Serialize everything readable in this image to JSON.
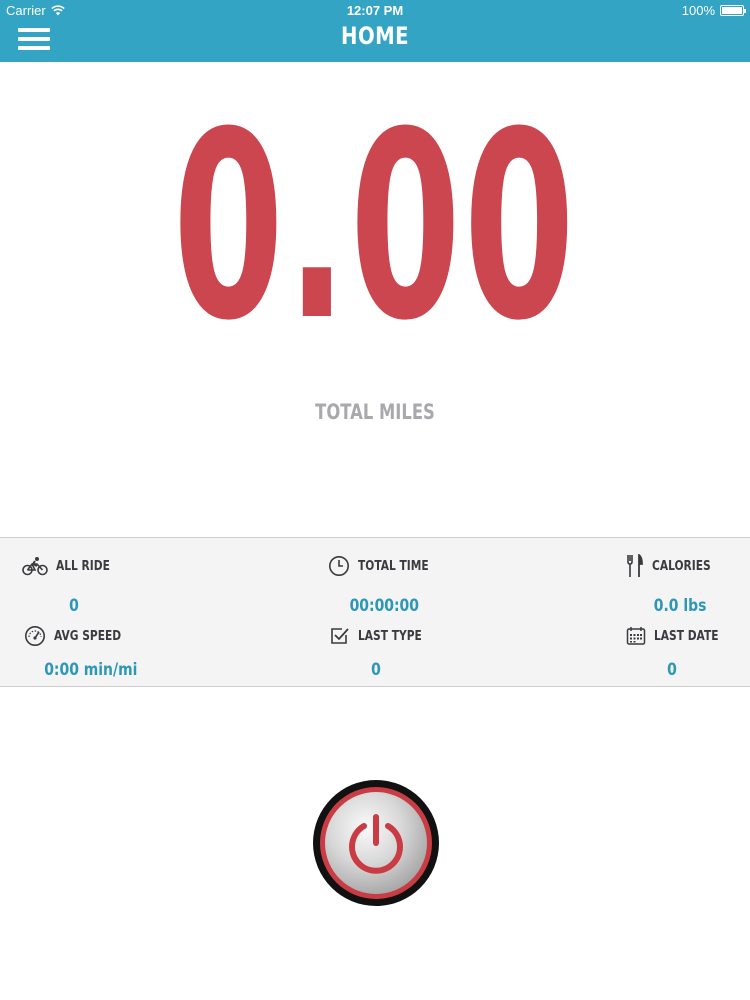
{
  "status_bar": {
    "carrier": "Carrier",
    "time": "12:07 PM",
    "battery": "100%"
  },
  "nav": {
    "title": "HOME",
    "menu_icon": "hamburger-menu-icon"
  },
  "main": {
    "value": "0.00",
    "label": "TOTAL MILES"
  },
  "stats": {
    "all_ride": {
      "label": "ALL RIDE",
      "value": "0",
      "icon": "bicycle-icon"
    },
    "total_time": {
      "label": "TOTAL TIME",
      "value": "00:00:00",
      "icon": "clock-icon"
    },
    "calories": {
      "label": "CALORIES",
      "value": "0.0 lbs",
      "icon": "fork-knife-icon"
    },
    "avg_speed": {
      "label": "AVG SPEED",
      "value": "0:00 min/mi",
      "icon": "speedometer-icon"
    },
    "last_type": {
      "label": "LAST TYPE",
      "value": "0",
      "icon": "checkbox-icon"
    },
    "last_date": {
      "label": "LAST DATE",
      "value": "0",
      "icon": "calendar-icon"
    }
  },
  "colors": {
    "header": "#33a4c4",
    "accent_red": "#cc4650",
    "stat_value": "#2d97b6",
    "label_gray": "#a9a9ad"
  },
  "power_button": {
    "icon": "power-icon"
  }
}
